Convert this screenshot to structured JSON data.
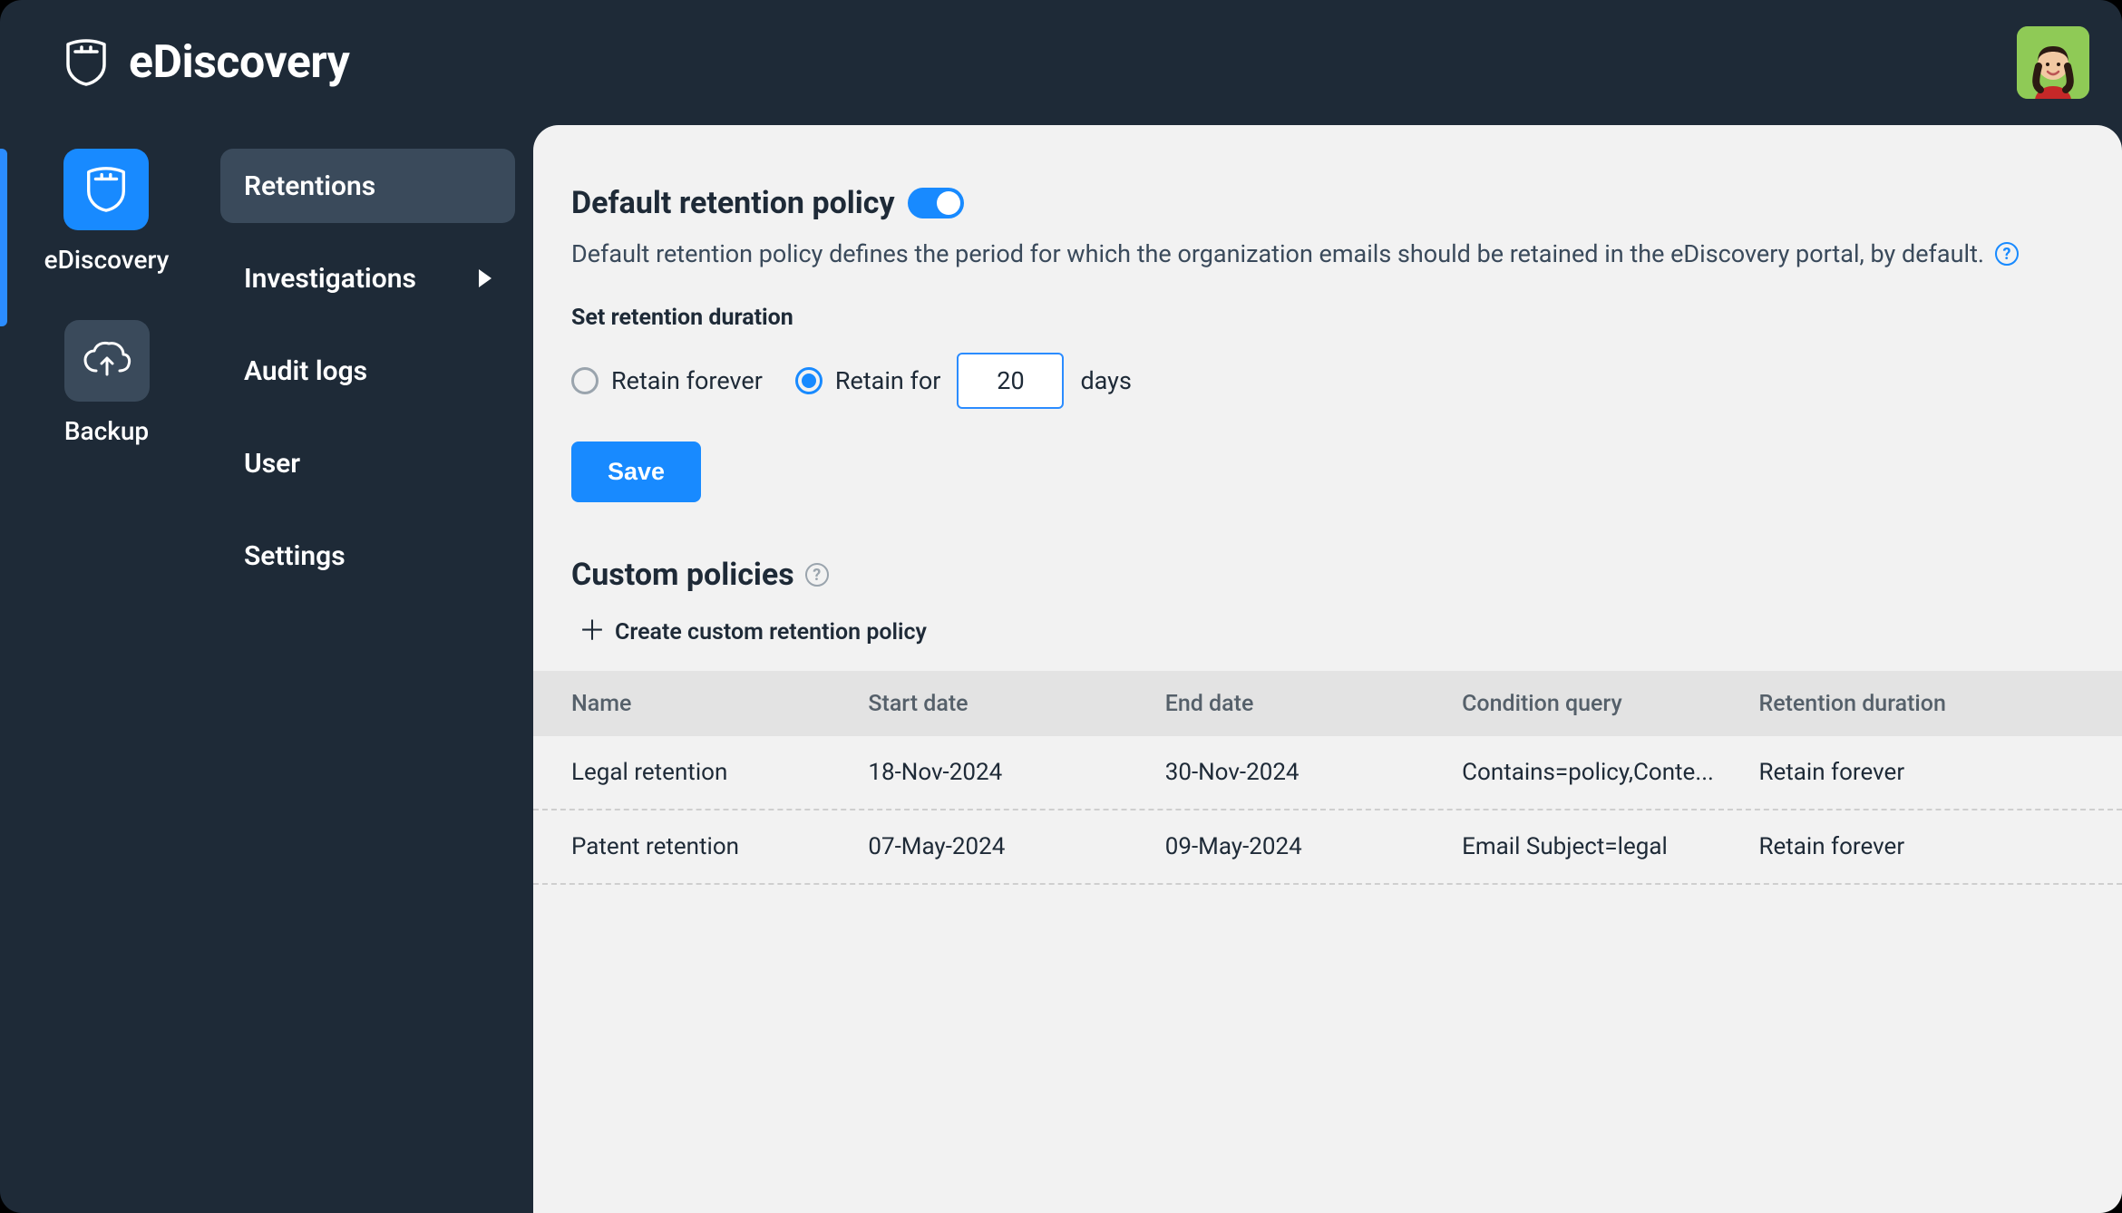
{
  "brand": {
    "title": "eDiscovery"
  },
  "rail": {
    "items": [
      {
        "label": "eDiscovery",
        "active": true
      },
      {
        "label": "Backup",
        "active": false
      }
    ]
  },
  "sidebar": {
    "items": [
      {
        "label": "Retentions",
        "active": true,
        "has_submenu": false
      },
      {
        "label": "Investigations",
        "active": false,
        "has_submenu": true
      },
      {
        "label": "Audit logs",
        "active": false,
        "has_submenu": false
      },
      {
        "label": "User",
        "active": false,
        "has_submenu": false
      },
      {
        "label": "Settings",
        "active": false,
        "has_submenu": false
      }
    ]
  },
  "main": {
    "policy_title": "Default retention policy",
    "policy_toggle_on": true,
    "policy_desc": "Default retention policy defines the period for which the organization emails should be retained in the eDiscovery portal, by default.",
    "set_duration_heading": "Set retention duration",
    "retain_forever_label": "Retain forever",
    "retain_for_label": "Retain for",
    "retain_for_value": "20",
    "days_suffix": "days",
    "retain_selected": "retain_for",
    "save_label": "Save",
    "custom_title": "Custom policies",
    "create_label": "Create custom retention policy",
    "table": {
      "columns": [
        "Name",
        "Start date",
        "End date",
        "Condition query",
        "Retention duration"
      ],
      "rows": [
        {
          "name": "Legal retention",
          "start": "18-Nov-2024",
          "end": "30-Nov-2024",
          "query": "Contains=policy,Conte...",
          "duration": "Retain forever"
        },
        {
          "name": "Patent retention",
          "start": "07-May-2024",
          "end": "09-May-2024",
          "query": "Email Subject=legal",
          "duration": "Retain forever"
        }
      ]
    }
  }
}
